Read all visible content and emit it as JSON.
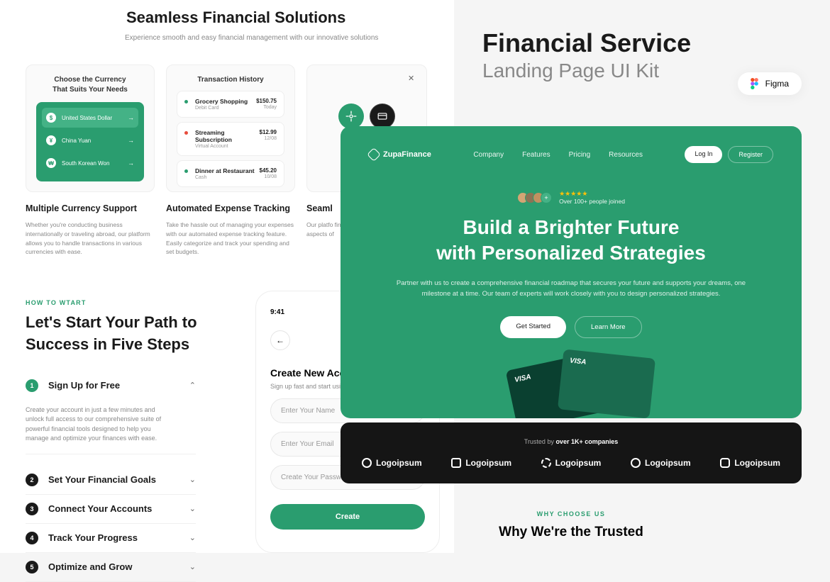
{
  "left": {
    "title": "Seamless Financial Solutions",
    "subtitle": "Experience smooth and easy financial management with our innovative solutions",
    "card1": {
      "title": "Choose the Currency\nThat Suits Your Needs",
      "currencies": [
        {
          "name": "United States Dollar",
          "symbol": "$"
        },
        {
          "name": "China Yuan",
          "symbol": "¥"
        },
        {
          "name": "South Korean Won",
          "symbol": "₩"
        }
      ]
    },
    "card2": {
      "title": "Transaction History",
      "transactions": [
        {
          "dot": "#2a9d6f",
          "name": "Grocery Shopping",
          "sub": "Debit Card",
          "amount": "$150.75",
          "date": "Today"
        },
        {
          "dot": "#e74c3c",
          "name": "Streaming Subscription",
          "sub": "Virtual Account",
          "amount": "$12.99",
          "date": "12/08"
        },
        {
          "dot": "#2a9d6f",
          "name": "Dinner at Restaurant",
          "sub": "Cash",
          "amount": "$45.20",
          "date": "10/08"
        }
      ]
    },
    "features": [
      {
        "title": "Multiple Currency Support",
        "desc": "Whether you're conducting business internationally or traveling abroad, our platform allows you to handle transactions in various currencies with ease."
      },
      {
        "title": "Automated Expense Tracking",
        "desc": "Take the hassle out of managing your expenses with our automated expense tracking feature. Easily categorize and track your spending and set budgets."
      },
      {
        "title": "Seaml",
        "desc": "Our platfo financial ap aspects of"
      }
    ],
    "eyebrow": "HOW TO WTART",
    "bigTitle": "Let's Start Your Path to Success in Five Steps",
    "steps": [
      {
        "num": "1",
        "label": "Sign Up for Free",
        "active": true,
        "desc": "Create your account in just a few minutes and unlock full access to our comprehensive suite of powerful financial tools designed to help you manage and optimize your finances with ease."
      },
      {
        "num": "2",
        "label": "Set Your Financial Goals"
      },
      {
        "num": "3",
        "label": "Connect Your Accounts"
      },
      {
        "num": "4",
        "label": "Track Your Progress"
      },
      {
        "num": "5",
        "label": "Optimize and Grow"
      }
    ],
    "phone": {
      "time": "9:41",
      "formTitle": "Create New Acco",
      "formSub": "Sign up fast and start usin  management.",
      "inputs": [
        "Enter Your Name",
        "Enter Your Email",
        "Create Your Passwor"
      ],
      "btn": "Create"
    }
  },
  "right": {
    "title": "Financial Service",
    "subtitle": "Landing Page UI Kit",
    "figma": "Figma",
    "hero": {
      "brand": "ZupaFinance",
      "nav": [
        "Company",
        "Features",
        "Pricing",
        "Resources"
      ],
      "login": "Log In",
      "register": "Register",
      "proof": "Over 100+ people joined",
      "title1": "Build a Brighter Future",
      "title2": "with Personalized Strategies",
      "desc": "Partner with us to create a comprehensive financial roadmap that secures your future and supports your dreams, one milestone at a time. Our team of experts will work closely with you to design personalized strategies.",
      "btn1": "Get Started",
      "btn2": "Learn More",
      "cardBrand": "VISA"
    },
    "trusted": {
      "text": "Trusted by ",
      "bold": "over 1K+ companies",
      "logo": "Logoipsum"
    },
    "why": {
      "eyebrow": "WHY CHOOSE US",
      "title": "Why We're the Trusted"
    }
  }
}
